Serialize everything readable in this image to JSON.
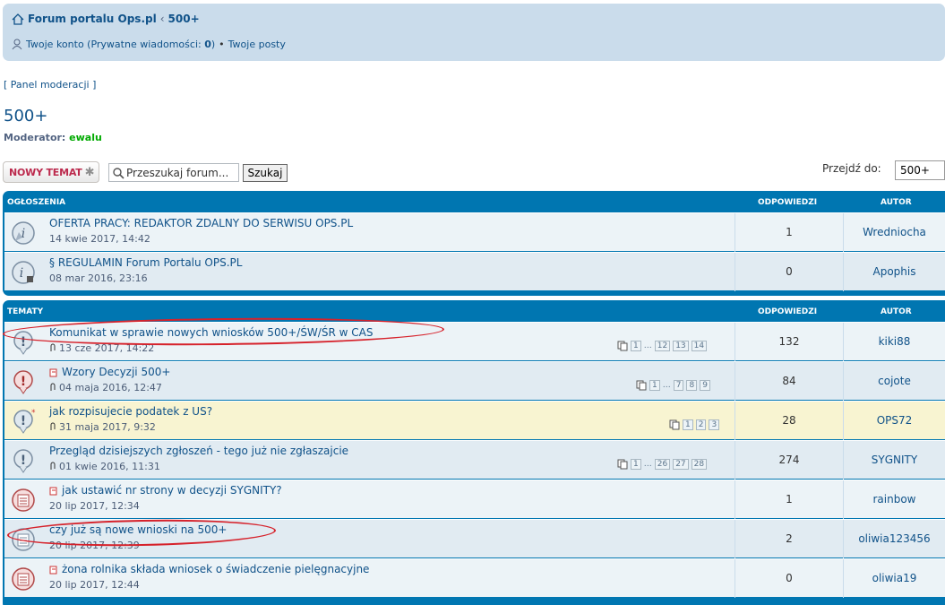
{
  "breadcrumb": {
    "home": "Forum portalu Ops.pl",
    "separator": "‹",
    "current": "500+"
  },
  "userbar": {
    "account_prefix": "Twoje konto (Prywatne wiadomości: ",
    "pm_count": "0",
    "account_suffix": ")",
    "bullet": "•",
    "my_posts": "Twoje posty"
  },
  "mod_panel": "[ Panel moderacji ]",
  "forum": {
    "title": "500+",
    "moderator_label": "Moderator:",
    "moderator_name": "ewalu"
  },
  "toolbar": {
    "new_topic": "NOWY TEMAT",
    "search_placeholder": "Przeszukaj forum...",
    "search_button": "Szukaj",
    "jump_label": "Przejdź do:",
    "jump_value": "500+"
  },
  "announcements": {
    "header": {
      "title": "Ogłoszenia",
      "replies": "Odpowiedzi",
      "author": "Autor"
    },
    "rows": [
      {
        "title": "OFERTA PRACY: REDAKTOR ZDALNY DO SERWISU OPS.PL",
        "date": "14 kwie 2017, 14:42",
        "replies": "1",
        "author": "Wredniocha"
      },
      {
        "title": "§ REGULAMIN Forum Portalu OPS.PL",
        "date": "08 mar 2016, 23:16",
        "replies": "0",
        "author": "Apophis"
      }
    ]
  },
  "topics": {
    "header": {
      "title": "Tematy",
      "replies": "Odpowiedzi",
      "author": "Autor"
    },
    "rows": [
      {
        "title": "Komunikat w sprawie nowych wniosków 500+/ŚW/ŚR w CAS",
        "date": "13 cze 2017, 14:22",
        "replies": "132",
        "author": "kiki88",
        "pages": [
          "1",
          "…",
          "12",
          "13",
          "14"
        ]
      },
      {
        "title": "Wzory Decyzji 500+",
        "date": "04 maja 2016, 12:47",
        "replies": "84",
        "author": "cojote",
        "pages": [
          "1",
          "…",
          "7",
          "8",
          "9"
        ]
      },
      {
        "title": "jak rozpisujecie podatek z US?",
        "date": "31 maja 2017, 9:32",
        "replies": "28",
        "author": "OPS72",
        "pages": [
          "1",
          "2",
          "3"
        ]
      },
      {
        "title": "Przegląd dzisiejszych zgłoszeń - tego już nie zgłaszajcie",
        "date": "01 kwie 2016, 11:31",
        "replies": "274",
        "author": "SYGNITY",
        "pages": [
          "1",
          "…",
          "26",
          "27",
          "28"
        ]
      },
      {
        "title": "jak ustawić nr strony w decyzji SYGNITY?",
        "date": "20 lip 2017, 12:34",
        "replies": "1",
        "author": "rainbow"
      },
      {
        "title": "czy już są nowe wnioski na 500+",
        "date": "20 lip 2017, 12:39",
        "replies": "2",
        "author": "oliwia123456"
      },
      {
        "title": "żona rolnika składa wniosek o świadczenie pielęgnacyjne",
        "date": "20 lip 2017, 12:44",
        "replies": "0",
        "author": "oliwia19"
      }
    ]
  },
  "colors": {
    "link": "#105289",
    "header_bg": "#0076b1",
    "annotation": "#d6222b",
    "moderator": "#00aa00"
  }
}
